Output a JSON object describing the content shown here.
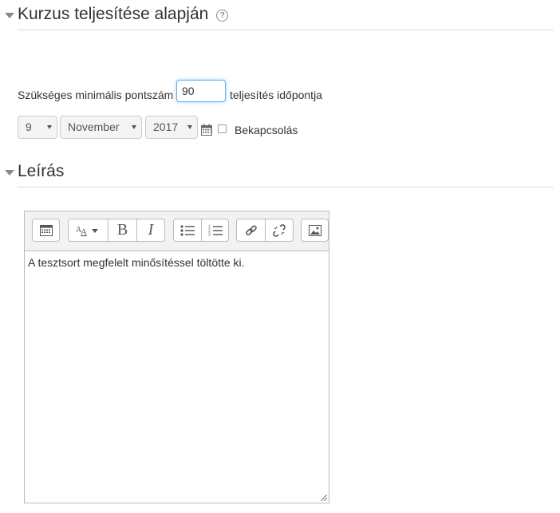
{
  "sections": {
    "completion": {
      "title": "Kurzus teljesítése alapján",
      "help": "?"
    },
    "description": {
      "title": "Leírás"
    }
  },
  "grade": {
    "label": "Szükséges minimális pontszám",
    "value": "90",
    "suffix": "teljesítés időpontja"
  },
  "date": {
    "day": "9",
    "month": "November",
    "year": "2017",
    "enable_label": "Bekapcsolás",
    "enabled": false
  },
  "editor": {
    "content": "A tesztsort megfelelt minősítéssel töltötte ki.",
    "buttons": {
      "bold": "B",
      "italic": "I"
    }
  }
}
